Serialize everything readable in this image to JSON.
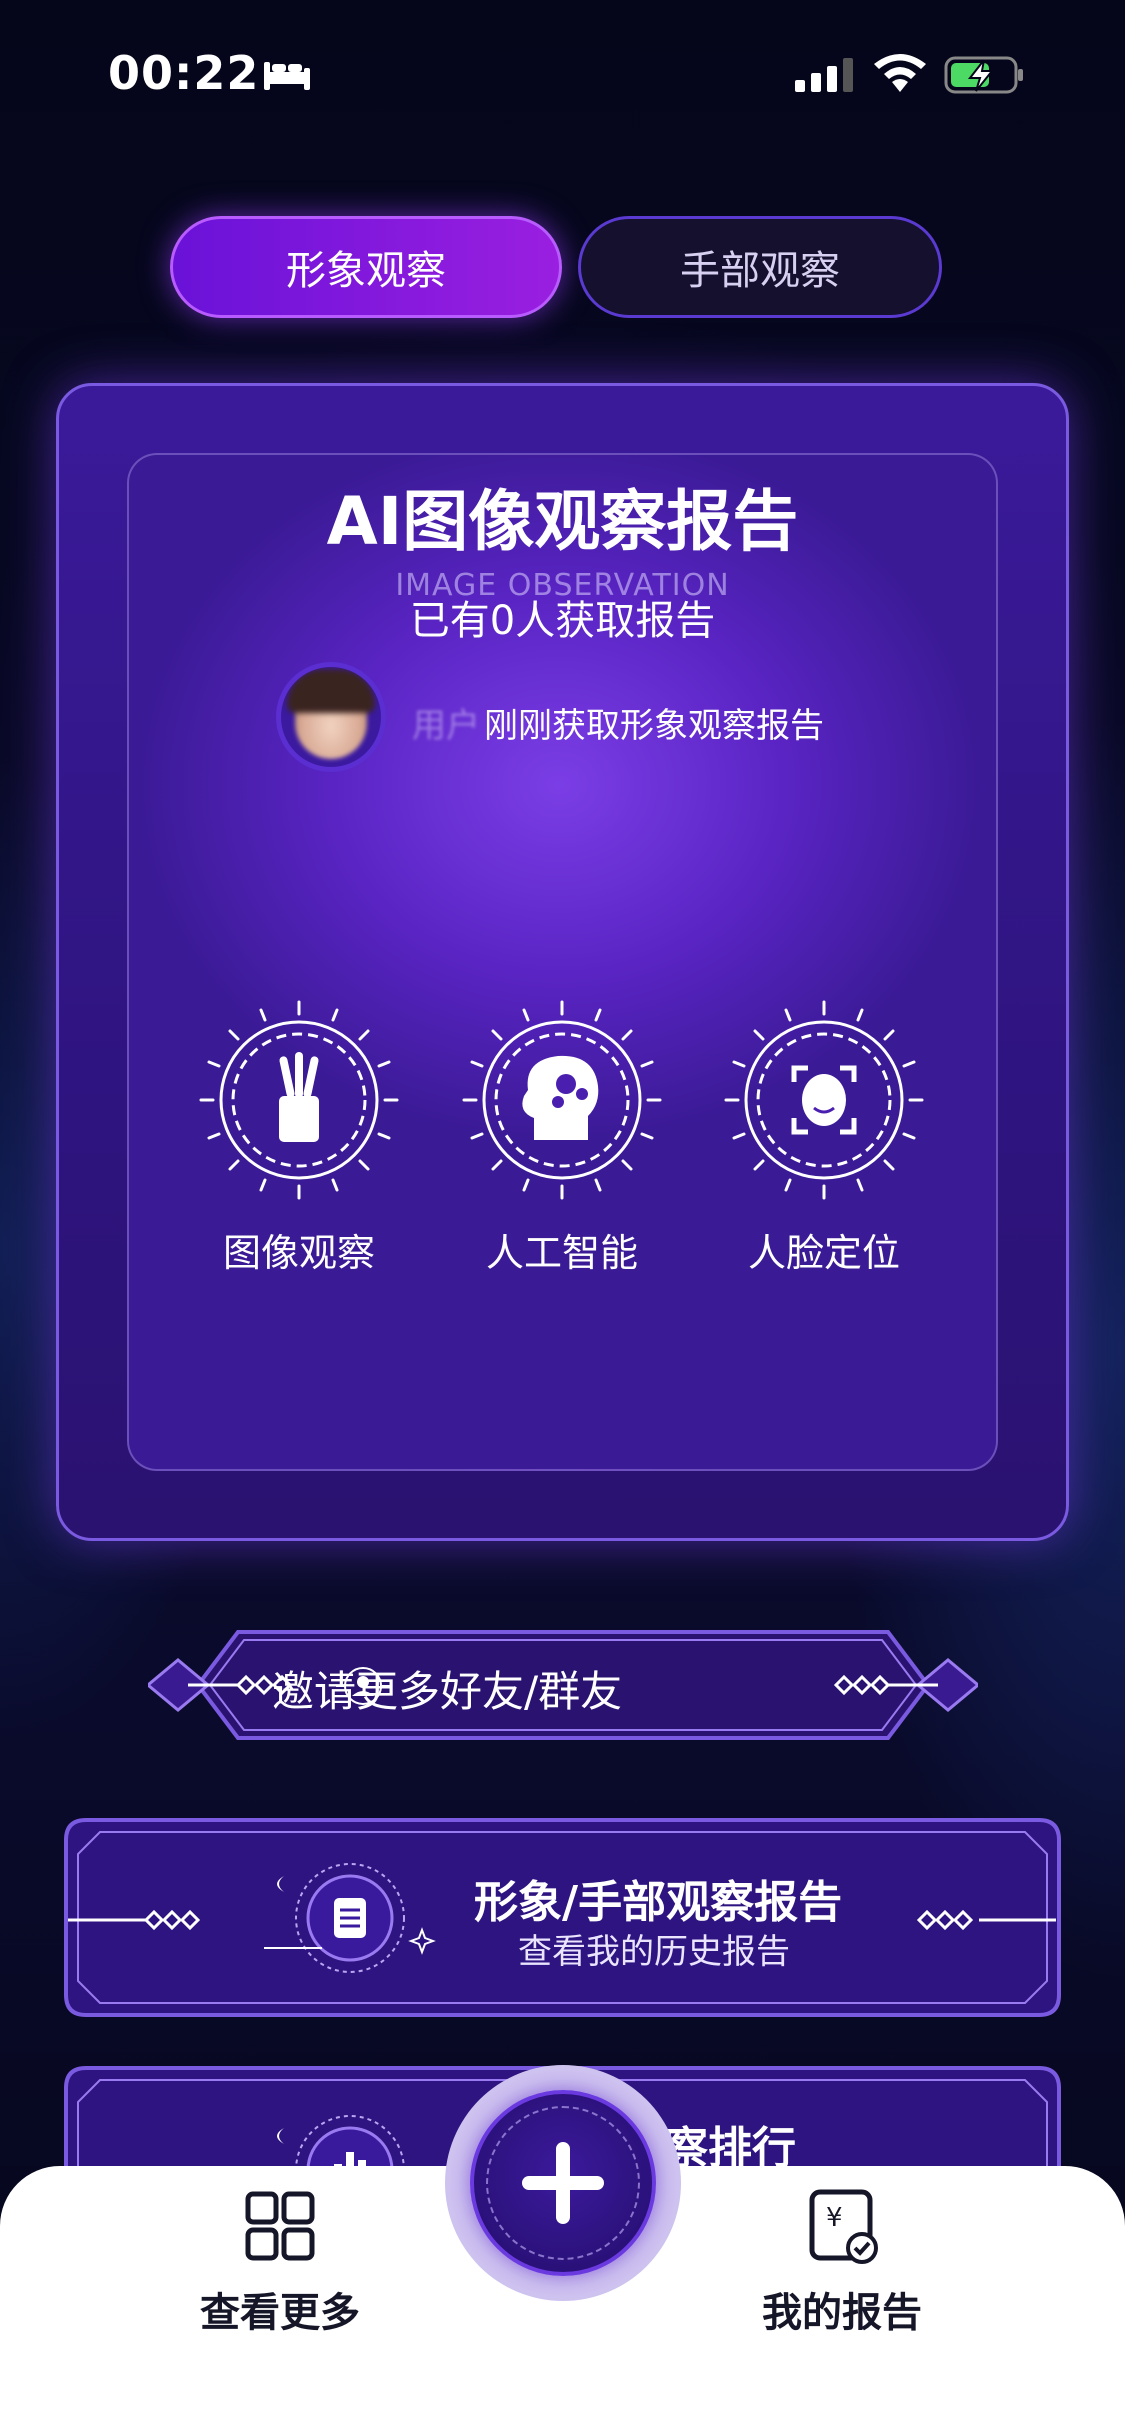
{
  "status_bar": {
    "time": "00:22"
  },
  "tabs": [
    {
      "label": "形象观察",
      "active": true
    },
    {
      "label": "手部观察",
      "active": false
    }
  ],
  "report_card": {
    "title": "AI图像观察报告",
    "subtitle": "IMAGE OBSERVATION",
    "count_text": "已有0人获取报告",
    "recent_user": "用户",
    "recent_text": "刚刚获取形象观察报告",
    "features": [
      {
        "label": "图像观察",
        "icon": "brush-cup-icon"
      },
      {
        "label": "人工智能",
        "icon": "ai-head-icon"
      },
      {
        "label": "人脸定位",
        "icon": "face-scan-icon"
      }
    ]
  },
  "invite": {
    "label": "邀请更多好友/群友"
  },
  "history_banner": {
    "title": "形象/手部观察报告",
    "subtitle": "查看我的历史报告"
  },
  "ranking_banner": {
    "title_visible": "观察排行"
  },
  "bottom_nav": {
    "left_label": "查看更多",
    "right_label": "我的报告"
  },
  "colors": {
    "accent": "#8a1fe0",
    "card_bg": "#3b1a9a",
    "nav_text": "#161629",
    "background": "#05061a"
  }
}
